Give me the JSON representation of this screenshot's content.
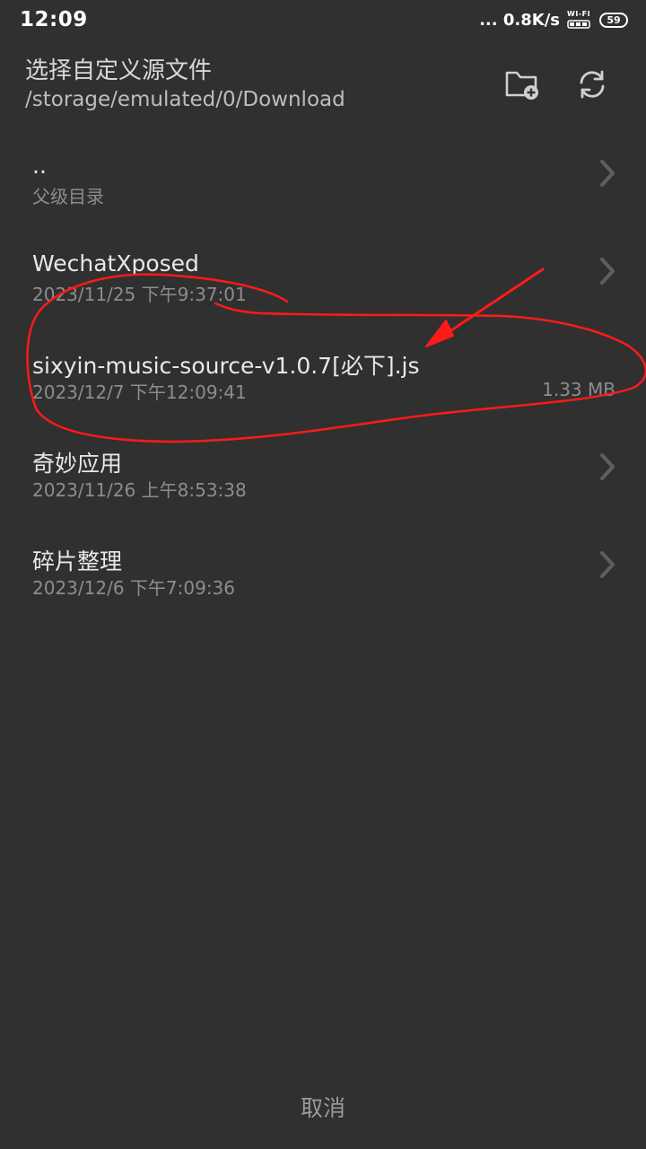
{
  "status_bar": {
    "time": "12:09",
    "network_speed": "... 0.8K/s",
    "wifi_label": "WI-FI",
    "battery_level": "59"
  },
  "header": {
    "title": "选择自定义源文件",
    "path": "/storage/emulated/0/Download",
    "new_folder_icon": "folder-add-icon",
    "refresh_icon": "refresh-icon"
  },
  "files": [
    {
      "name": "..",
      "subtitle": "父级目录",
      "size": "",
      "is_dir": true
    },
    {
      "name": "WechatXposed",
      "subtitle": "2023/11/25 下午9:37:01",
      "size": "",
      "is_dir": true
    },
    {
      "name": "sixyin-music-source-v1.0.7[必下].js",
      "subtitle": "2023/12/7 下午12:09:41",
      "size": "1.33 MB",
      "is_dir": false
    },
    {
      "name": "奇妙应用",
      "subtitle": "2023/11/26 上午8:53:38",
      "size": "",
      "is_dir": true
    },
    {
      "name": "碎片整理",
      "subtitle": "2023/12/6 下午7:09:36",
      "size": "",
      "is_dir": true
    }
  ],
  "footer": {
    "cancel_label": "取消"
  },
  "colors": {
    "background": "#303030",
    "annotation": "#ff1a1a"
  }
}
